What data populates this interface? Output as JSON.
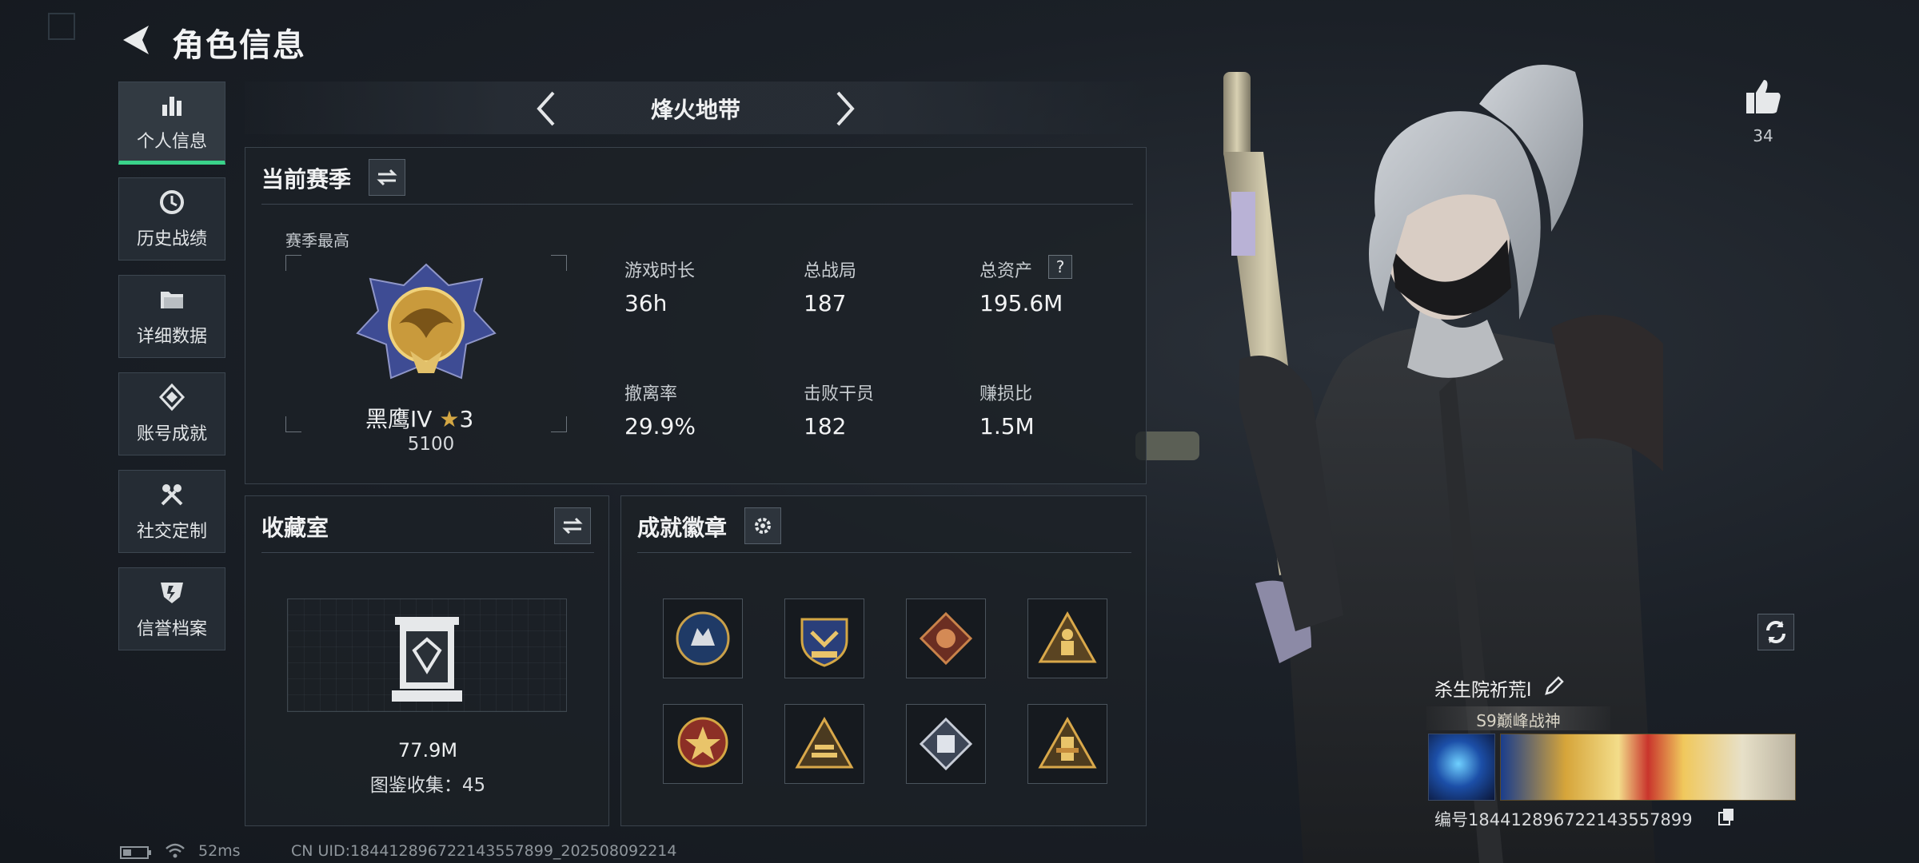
{
  "header": {
    "title": "角色信息"
  },
  "nav": [
    {
      "label": "个人信息",
      "icon": "bar-chart-icon",
      "active": true
    },
    {
      "label": "历史战绩",
      "icon": "history-clock-icon",
      "active": false
    },
    {
      "label": "详细数据",
      "icon": "folder-icon",
      "active": false
    },
    {
      "label": "账号成就",
      "icon": "achievement-diamond-icon",
      "active": false
    },
    {
      "label": "社交定制",
      "icon": "tools-icon",
      "active": false
    },
    {
      "label": "信誉档案",
      "icon": "credit-shield-icon",
      "active": false
    }
  ],
  "map": {
    "title": "烽火地带"
  },
  "season": {
    "title": "当前赛季",
    "best_label": "赛季最高",
    "rank_name": "黑鹰IV",
    "rank_stars": "3",
    "rank_score": "5100",
    "stats": [
      {
        "label": "游戏时长",
        "value": "36h"
      },
      {
        "label": "总战局",
        "value": "187"
      },
      {
        "label": "总资产",
        "value": "195.6M"
      },
      {
        "label": "撤离率",
        "value": "29.9%"
      },
      {
        "label": "击败干员",
        "value": "182"
      },
      {
        "label": "赚损比",
        "value": "1.5M"
      }
    ]
  },
  "collection": {
    "title": "收藏室",
    "value": "77.9M",
    "count_text": "图鉴收集：45"
  },
  "badges": {
    "title": "成就徽章",
    "items": [
      "wolf-emblem-icon",
      "shield-wings-emblem-icon",
      "dragon-emblem-icon",
      "soldier-triangle-icon",
      "star-medal-icon",
      "bars-triangle-icon",
      "cube-diamond-icon",
      "tower-triangle-icon"
    ]
  },
  "profile": {
    "likes": "34",
    "name": "杀生院祈荒l",
    "title": "S9巅峰战神",
    "uid_text": "编号1844128967221435578​99"
  },
  "status": {
    "ping": "52ms",
    "uid": "CN UID:1844128967221435578​99_202508092214"
  },
  "colors": {
    "accent": "#3ad38a",
    "gold": "#d4a744",
    "panel": "#1c2127"
  }
}
